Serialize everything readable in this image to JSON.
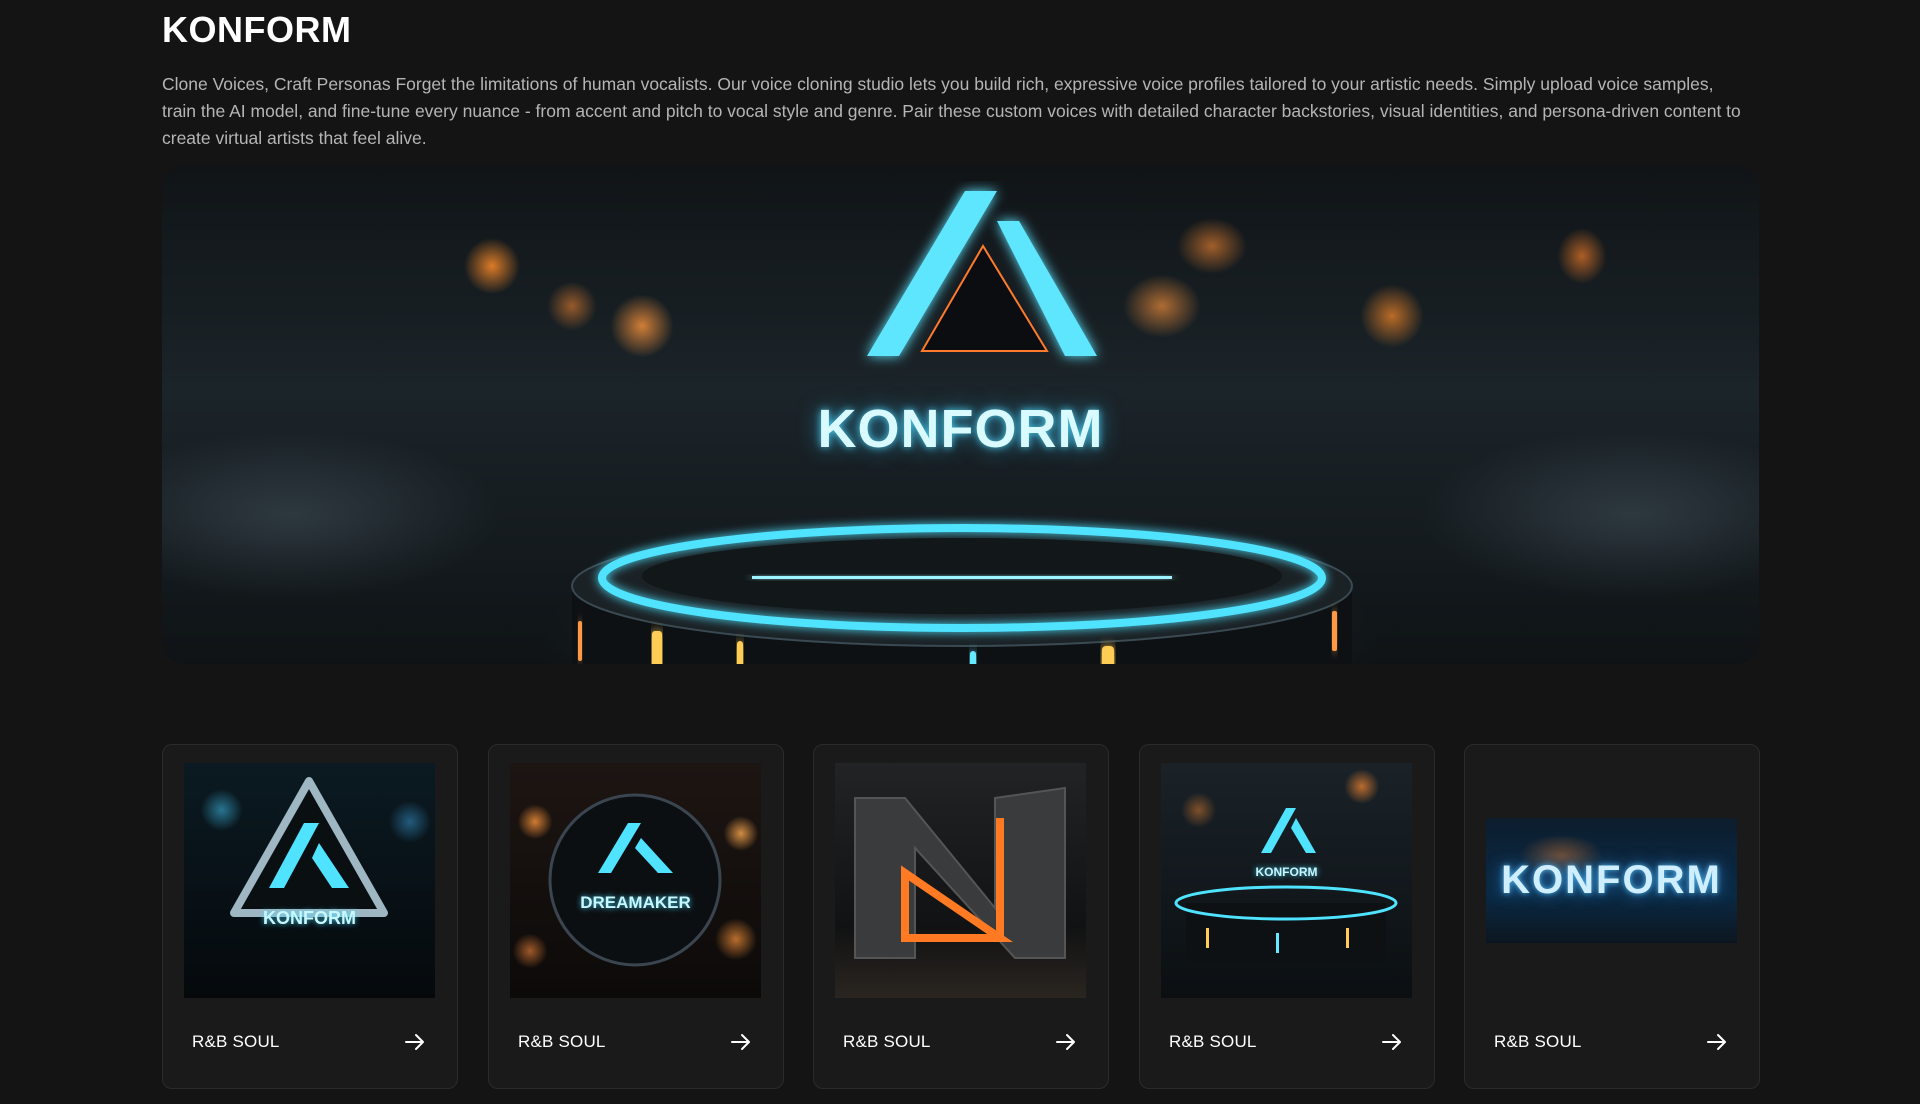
{
  "page": {
    "title": "KONFORM",
    "description": "Clone Voices, Craft Personas Forget the limitations of human vocalists. Our voice cloning studio lets you build rich, expressive voice profiles tailored to your artistic needs. Simply upload voice samples, train the AI model, and fine-tune every nuance - from accent and pitch to vocal style and genre. Pair these custom voices with detailed character backstories, visual identities, and persona-driven content to create virtual artists that feel alive."
  },
  "hero": {
    "wordmark": "KONFORM",
    "accent_color": "#4fe3ff",
    "glow_color": "#ff8a2a"
  },
  "cards": [
    {
      "label": "R&B SOUL",
      "thumb_text": "KONFORM",
      "icon": "arrow-right-icon"
    },
    {
      "label": "R&B SOUL",
      "thumb_text": "DREAMAKER",
      "icon": "arrow-right-icon"
    },
    {
      "label": "R&B SOUL",
      "thumb_text": "",
      "icon": "arrow-right-icon"
    },
    {
      "label": "R&B SOUL",
      "thumb_text": "KONFORM",
      "icon": "arrow-right-icon"
    },
    {
      "label": "R&B SOUL",
      "thumb_text": "KONFORM",
      "icon": "arrow-right-icon"
    }
  ]
}
